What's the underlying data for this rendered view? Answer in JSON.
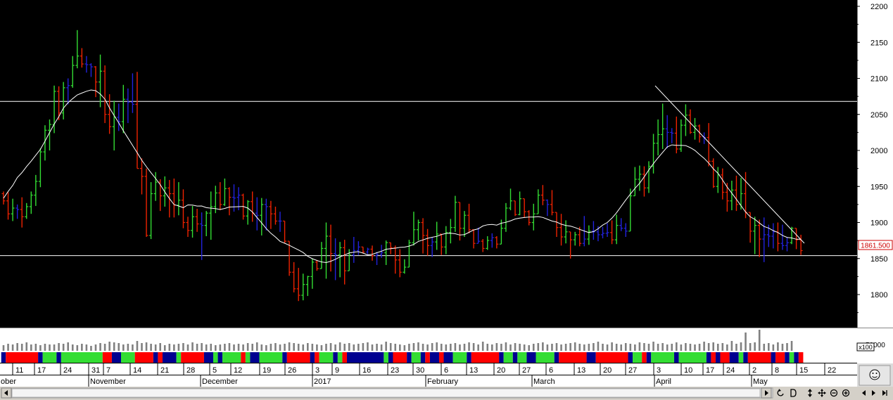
{
  "chart_data": {
    "type": "bar",
    "subtype": "ohlc",
    "title": "",
    "xlabel": "",
    "ylabel": "",
    "ylim": [
      1767,
      2210
    ],
    "y_ticks": [
      "2200",
      "2150",
      "2100",
      "2050",
      "2000",
      "1950",
      "1900",
      "1850",
      "1800"
    ],
    "last_price_label": "1861.500",
    "horizontal_lines": [
      2068,
      1854
    ],
    "volume_scale_label": "x100",
    "volume_axis_label": "50000",
    "colors": {
      "up": "#33dd33",
      "down": "#ee2200",
      "neutral": "#2222dd",
      "background": "#000000",
      "moving_average": "#ffffff",
      "volume": "#808080"
    },
    "x_ticks": [
      "11",
      "17",
      "24",
      "31",
      "7",
      "14",
      "21",
      "28",
      "5",
      "12",
      "19",
      "26",
      "3",
      "9",
      "16",
      "23",
      "30",
      "6",
      "13",
      "20",
      "27",
      "6",
      "13",
      "20",
      "27",
      "3",
      "10",
      "17",
      "24",
      "2",
      "8",
      "15",
      "22"
    ],
    "months": [
      "ober",
      "November",
      "December",
      "2017",
      "February",
      "March",
      "April",
      "May"
    ],
    "ohlc": [
      [
        1940,
        1943,
        1925,
        1930
      ],
      [
        1930,
        1942,
        1904,
        1912
      ],
      [
        1912,
        1933,
        1902,
        1920
      ],
      [
        1920,
        1925,
        1905,
        1918
      ],
      [
        1918,
        1935,
        1893,
        1908
      ],
      [
        1908,
        1927,
        1905,
        1922
      ],
      [
        1922,
        1943,
        1912,
        1938
      ],
      [
        1938,
        1966,
        1923,
        1957
      ],
      [
        1957,
        2003,
        1949,
        1998
      ],
      [
        1998,
        2035,
        1986,
        2028
      ],
      [
        2028,
        2043,
        2000,
        2036
      ],
      [
        2036,
        2090,
        2024,
        2082
      ],
      [
        2082,
        2089,
        2042,
        2052
      ],
      [
        2052,
        2095,
        2043,
        2087
      ],
      [
        2087,
        2100,
        2064,
        2090
      ],
      [
        2090,
        2131,
        2087,
        2118
      ],
      [
        2118,
        2167,
        2114,
        2131
      ],
      [
        2131,
        2142,
        2115,
        2120
      ],
      [
        2120,
        2131,
        2108,
        2119
      ],
      [
        2119,
        2121,
        2102,
        2116
      ],
      [
        2116,
        2117,
        2074,
        2095
      ],
      [
        2095,
        2133,
        2060,
        2110
      ],
      [
        2110,
        2118,
        2038,
        2050
      ],
      [
        2050,
        2078,
        2023,
        2033
      ],
      [
        2033,
        2069,
        2000,
        2046
      ],
      [
        2046,
        2065,
        2027,
        2040
      ],
      [
        2040,
        2091,
        2024,
        2071
      ],
      [
        2071,
        2086,
        2038,
        2067
      ],
      [
        2067,
        2107,
        2052,
        2064
      ],
      [
        2064,
        2109,
        1976,
        1975
      ],
      [
        1975,
        1989,
        1939,
        1964
      ],
      [
        1964,
        1975,
        1880,
        1882
      ],
      [
        1882,
        1956,
        1877,
        1940
      ],
      [
        1940,
        1970,
        1930,
        1956
      ],
      [
        1956,
        1960,
        1916,
        1937
      ],
      [
        1937,
        1964,
        1922,
        1948
      ],
      [
        1948,
        1959,
        1907,
        1940
      ],
      [
        1940,
        1961,
        1907,
        1924
      ],
      [
        1924,
        1956,
        1910,
        1931
      ],
      [
        1931,
        1946,
        1892,
        1900
      ],
      [
        1900,
        1908,
        1880,
        1889
      ],
      [
        1889,
        1923,
        1879,
        1908
      ],
      [
        1908,
        1919,
        1887,
        1898
      ],
      [
        1898,
        1914,
        1848,
        1896
      ],
      [
        1896,
        1916,
        1881,
        1913
      ],
      [
        1913,
        1943,
        1876,
        1922
      ],
      [
        1922,
        1951,
        1913,
        1941
      ],
      [
        1941,
        1956,
        1917,
        1925
      ],
      [
        1925,
        1961,
        1923,
        1947
      ],
      [
        1947,
        1949,
        1910,
        1935
      ],
      [
        1935,
        1953,
        1915,
        1934
      ],
      [
        1935,
        1949,
        1917,
        1938
      ],
      [
        1938,
        1940,
        1904,
        1909
      ],
      [
        1909,
        1931,
        1897,
        1929
      ],
      [
        1929,
        1943,
        1901,
        1913
      ],
      [
        1913,
        1935,
        1889,
        1910
      ],
      [
        1910,
        1934,
        1882,
        1925
      ],
      [
        1925,
        1933,
        1889,
        1922
      ],
      [
        1922,
        1930,
        1891,
        1912
      ],
      [
        1912,
        1922,
        1897,
        1902
      ],
      [
        1902,
        1915,
        1887,
        1902
      ],
      [
        1902,
        1896,
        1871,
        1874
      ],
      [
        1874,
        1857,
        1826,
        1831
      ],
      [
        1831,
        1845,
        1803,
        1808
      ],
      [
        1808,
        1837,
        1791,
        1799
      ],
      [
        1799,
        1829,
        1792,
        1814
      ],
      [
        1814,
        1826,
        1798,
        1825
      ],
      [
        1825,
        1850,
        1808,
        1845
      ],
      [
        1845,
        1848,
        1833,
        1836
      ],
      [
        1836,
        1873,
        1849,
        1864
      ],
      [
        1864,
        1900,
        1822,
        1881
      ],
      [
        1881,
        1897,
        1832,
        1857
      ],
      [
        1857,
        1878,
        1820,
        1855
      ],
      [
        1855,
        1873,
        1824,
        1865
      ],
      [
        1865,
        1876,
        1814,
        1833
      ],
      [
        1833,
        1863,
        1841,
        1855
      ],
      [
        1855,
        1880,
        1844,
        1861
      ],
      [
        1861,
        1874,
        1855,
        1866
      ],
      [
        1866,
        1864,
        1857,
        1859
      ],
      [
        1859,
        1865,
        1856,
        1863
      ],
      [
        1863,
        1868,
        1847,
        1854
      ],
      [
        1854,
        1859,
        1841,
        1856
      ],
      [
        1856,
        1869,
        1851,
        1858
      ],
      [
        1858,
        1875,
        1841,
        1872
      ],
      [
        1872,
        1868,
        1856,
        1865
      ],
      [
        1865,
        1868,
        1829,
        1848
      ],
      [
        1848,
        1863,
        1824,
        1831
      ],
      [
        1831,
        1849,
        1829,
        1838
      ],
      [
        1838,
        1876,
        1858,
        1872
      ],
      [
        1872,
        1915,
        1868,
        1890
      ],
      [
        1890,
        1904,
        1875,
        1900
      ],
      [
        1900,
        1906,
        1857,
        1882
      ],
      [
        1882,
        1891,
        1854,
        1868
      ],
      [
        1868,
        1879,
        1852,
        1873
      ],
      [
        1873,
        1901,
        1862,
        1884
      ],
      [
        1884,
        1883,
        1855,
        1866
      ],
      [
        1866,
        1895,
        1856,
        1886
      ],
      [
        1886,
        1905,
        1871,
        1893
      ],
      [
        1893,
        1937,
        1887,
        1928
      ],
      [
        1928,
        1926,
        1875,
        1892
      ],
      [
        1892,
        1916,
        1880,
        1910
      ],
      [
        1910,
        1926,
        1885,
        1890
      ],
      [
        1890,
        1885,
        1864,
        1871
      ],
      [
        1871,
        1893,
        1871,
        1874
      ],
      [
        1874,
        1877,
        1859,
        1864
      ],
      [
        1864,
        1881,
        1862,
        1875
      ],
      [
        1875,
        1885,
        1865,
        1879
      ],
      [
        1879,
        1881,
        1864,
        1870
      ],
      [
        1870,
        1904,
        1870,
        1892
      ],
      [
        1892,
        1927,
        1887,
        1920
      ],
      [
        1920,
        1947,
        1917,
        1930
      ],
      [
        1930,
        1926,
        1909,
        1911
      ],
      [
        1911,
        1943,
        1910,
        1933
      ],
      [
        1933,
        1923,
        1907,
        1915
      ],
      [
        1915,
        1917,
        1896,
        1900
      ],
      [
        1900,
        1926,
        1889,
        1912
      ],
      [
        1912,
        1946,
        1916,
        1938
      ],
      [
        1938,
        1952,
        1924,
        1931
      ],
      [
        1931,
        1932,
        1909,
        1925
      ],
      [
        1925,
        1945,
        1910,
        1914
      ],
      [
        1914,
        1902,
        1880,
        1893
      ],
      [
        1893,
        1912,
        1868,
        1880
      ],
      [
        1880,
        1903,
        1871,
        1887
      ],
      [
        1887,
        1885,
        1850,
        1876
      ],
      [
        1876,
        1887,
        1868,
        1883
      ],
      [
        1883,
        1894,
        1867,
        1871
      ],
      [
        1871,
        1909,
        1867,
        1877
      ],
      [
        1877,
        1896,
        1869,
        1888
      ],
      [
        1888,
        1902,
        1876,
        1887
      ],
      [
        1887,
        1895,
        1874,
        1883
      ],
      [
        1883,
        1894,
        1878,
        1885
      ],
      [
        1885,
        1899,
        1880,
        1886
      ],
      [
        1886,
        1903,
        1870,
        1876
      ],
      [
        1876,
        1911,
        1870,
        1896
      ],
      [
        1896,
        1906,
        1888,
        1892
      ],
      [
        1892,
        1899,
        1880,
        1888
      ],
      [
        1888,
        1947,
        1900,
        1937
      ],
      [
        1937,
        1977,
        1937,
        1960
      ],
      [
        1960,
        1979,
        1944,
        1967
      ],
      [
        1967,
        1978,
        1936,
        1948
      ],
      [
        1948,
        1985,
        1941,
        1978
      ],
      [
        1978,
        2023,
        1968,
        2010
      ],
      [
        2010,
        2043,
        1993,
        2022
      ],
      [
        2022,
        2065,
        2002,
        2030
      ],
      [
        2030,
        2049,
        2003,
        2025
      ],
      [
        2025,
        2031,
        2010,
        2024
      ],
      [
        2024,
        2047,
        1996,
        2002
      ],
      [
        2002,
        2043,
        1998,
        2035
      ],
      [
        2035,
        2064,
        2020,
        2049
      ],
      [
        2049,
        2057,
        2023,
        2025
      ],
      [
        2025,
        2045,
        2015,
        2034
      ],
      [
        2034,
        2036,
        2011,
        2019
      ],
      [
        2019,
        2025,
        2009,
        2018
      ],
      [
        2018,
        2038,
        1978,
        1985
      ],
      [
        1985,
        1989,
        1948,
        1950
      ],
      [
        1950,
        1977,
        1941,
        1966
      ],
      [
        1966,
        1975,
        1932,
        1942
      ],
      [
        1942,
        1955,
        1915,
        1930
      ],
      [
        1930,
        1958,
        1917,
        1945
      ],
      [
        1945,
        1965,
        1916,
        1925
      ],
      [
        1925,
        1962,
        1918,
        1940
      ],
      [
        1940,
        1970,
        1906,
        1914
      ],
      [
        1914,
        1913,
        1872,
        1888
      ],
      [
        1888,
        1908,
        1856,
        1896
      ],
      [
        1896,
        1904,
        1852,
        1877
      ],
      [
        1877,
        1907,
        1845,
        1883
      ],
      [
        1883,
        1897,
        1866,
        1881
      ],
      [
        1881,
        1899,
        1864,
        1887
      ],
      [
        1887,
        1900,
        1860,
        1871
      ],
      [
        1871,
        1897,
        1862,
        1868
      ],
      [
        1868,
        1880,
        1860,
        1872
      ],
      [
        1872,
        1894,
        1870,
        1892
      ],
      [
        1892,
        1888,
        1863,
        1876
      ],
      [
        1876,
        1883,
        1855,
        1861
      ]
    ],
    "volume": [
      8,
      10,
      9,
      11,
      10,
      12,
      9,
      10,
      8,
      10,
      9,
      9,
      11,
      10,
      12,
      9,
      8,
      10,
      9,
      7,
      9,
      11,
      10,
      13,
      12,
      11,
      9,
      10,
      9,
      14,
      11,
      12,
      10,
      9,
      11,
      8,
      10,
      9,
      10,
      11,
      9,
      12,
      10,
      11,
      9,
      10,
      8,
      9,
      10,
      11,
      9,
      10,
      9,
      11,
      10,
      12,
      9,
      8,
      10,
      11,
      9,
      10,
      12,
      11,
      10,
      9,
      11,
      10,
      9,
      8,
      10,
      11,
      9,
      12,
      10,
      11,
      9,
      10,
      11,
      12,
      9,
      10,
      9,
      13,
      11,
      10,
      9,
      8,
      10,
      11,
      12,
      10,
      9,
      11,
      12,
      10,
      9,
      10,
      11,
      9,
      10,
      12,
      11,
      9,
      13,
      10,
      9,
      11,
      10,
      12,
      9,
      11,
      10,
      9,
      8,
      10,
      11,
      12,
      9,
      10,
      11,
      9,
      10,
      11,
      12,
      10,
      9,
      10,
      11,
      13,
      10,
      9,
      12,
      10,
      9,
      11,
      10,
      9,
      12,
      11,
      10,
      13,
      10,
      11,
      9,
      10,
      12,
      9,
      11,
      10,
      9,
      10,
      13,
      11,
      12,
      10,
      11,
      9,
      14,
      10,
      12,
      26,
      11,
      12,
      30,
      10,
      11,
      9,
      12,
      10,
      11,
      14
    ]
  }
}
